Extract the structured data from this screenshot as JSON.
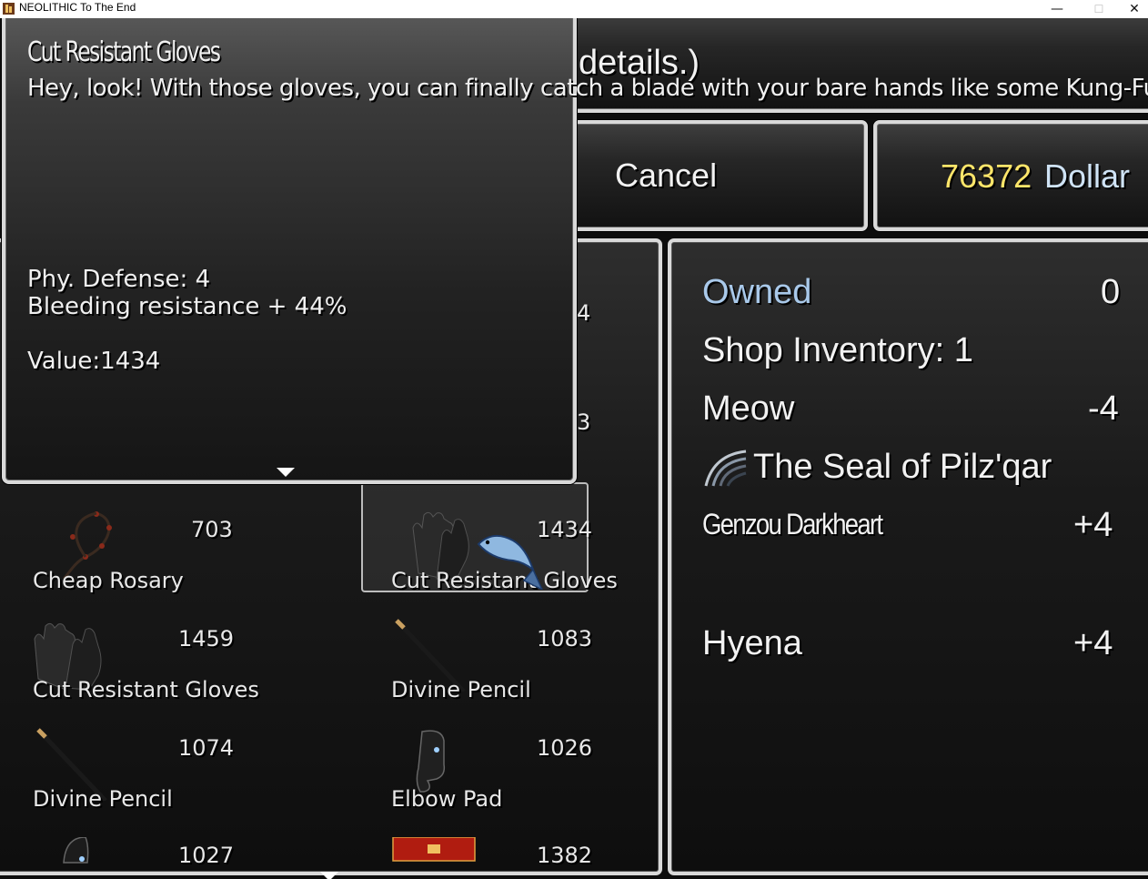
{
  "window": {
    "title": "NEOLITHIC To The End",
    "minimize": "—",
    "maximize": "☐",
    "close": "✕"
  },
  "help": {
    "text": "details.)"
  },
  "command": {
    "cancel": "Cancel"
  },
  "gold": {
    "amount": "76372",
    "unit": "Dollar"
  },
  "status": {
    "owned_label": "Owned",
    "owned_value": "0",
    "inventory": "Shop Inventory: 1",
    "meow_label": "Meow",
    "meow_value": "-4",
    "seal_label": "The Seal of Pilz'qar",
    "genzou_label": "Genzou Darkheart",
    "genzou_value": "+4",
    "hyena_label": "Hyena",
    "hyena_value": "+4"
  },
  "tooltip": {
    "title": "Cut Resistant Gloves",
    "description": "Hey, look! With those gloves, you\ncan finally catch a blade with your\nbare hands like some Kung-Fu stars\nin movies. Let's just hope they had\nsome quality control during production.",
    "defense": "Phy. Defense: 4",
    "bleeding": "Bleeding resistance + 44%",
    "value": "Value:1434"
  },
  "list": {
    "hidden_prices": [
      "4",
      "3"
    ],
    "items": [
      {
        "name": "Cheap Rosary",
        "price": "703",
        "icon": "rosary-icon"
      },
      {
        "name": "Cut Resistant Gloves",
        "price": "1434",
        "icon": "gloves-icon",
        "selected": true
      },
      {
        "name": "Cut Resistant Gloves",
        "price": "1459",
        "icon": "gloves-icon"
      },
      {
        "name": "Divine Pencil",
        "price": "1083",
        "icon": "pencil-icon"
      },
      {
        "name": "Divine Pencil",
        "price": "1074",
        "icon": "pencil-icon"
      },
      {
        "name": "Elbow Pad",
        "price": "1026",
        "icon": "elbow-pad-icon"
      },
      {
        "name": "",
        "price": "1027",
        "icon": "helmet-icon"
      },
      {
        "name": "",
        "price": "1382",
        "icon": "red-banner-icon"
      }
    ]
  },
  "colors": {
    "gold": "#ffe66a",
    "owned": "#a9c9ea",
    "bleeding": "#f0e88a",
    "frame": "#d9d9d9"
  }
}
